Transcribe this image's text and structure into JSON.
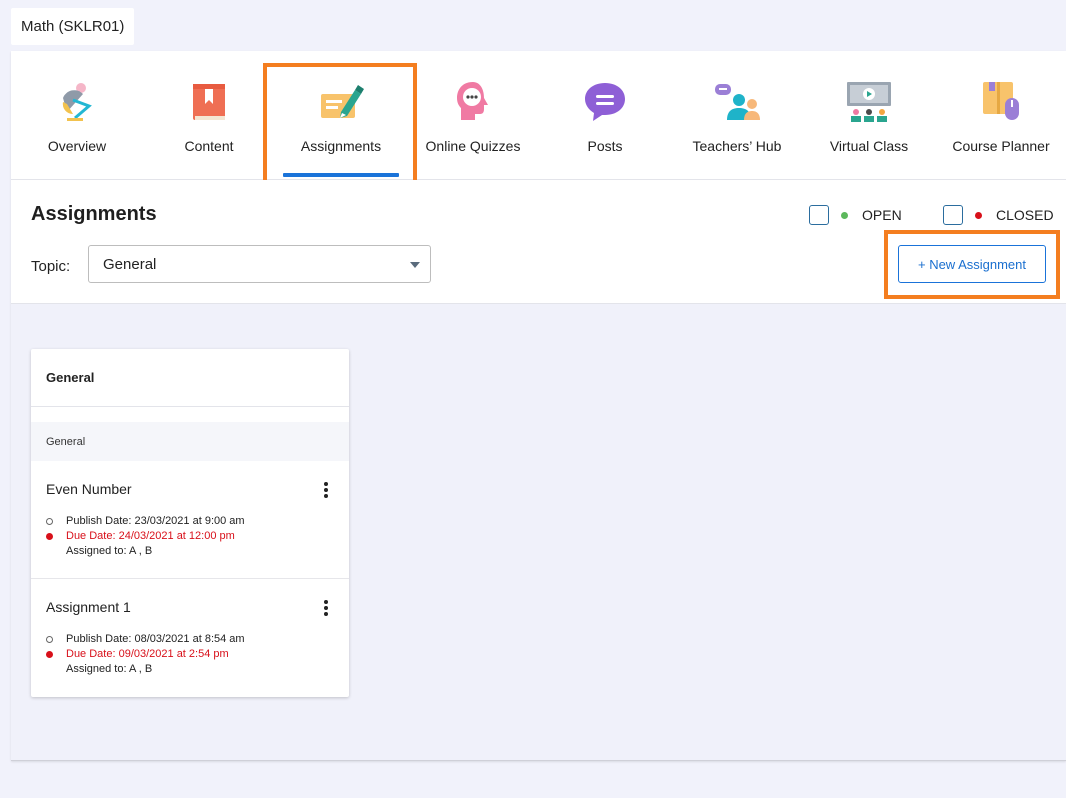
{
  "course": {
    "name": "Math (SKLR01)"
  },
  "nav": {
    "items": [
      {
        "label": "Overview",
        "icon": "desk-lamp-icon"
      },
      {
        "label": "Content",
        "icon": "book-icon"
      },
      {
        "label": "Assignments",
        "icon": "pen-paper-icon",
        "active": true
      },
      {
        "label": "Online Quizzes",
        "icon": "quiz-head-icon"
      },
      {
        "label": "Posts",
        "icon": "chat-bubble-icon"
      },
      {
        "label": "Teachers’ Hub",
        "icon": "people-chat-icon"
      },
      {
        "label": "Virtual Class",
        "icon": "video-screen-icon"
      },
      {
        "label": "Course Planner",
        "icon": "planner-mouse-icon"
      }
    ]
  },
  "header": {
    "title": "Assignments",
    "legend": {
      "open_label": "OPEN",
      "closed_label": "CLOSED"
    },
    "topic_label": "Topic:",
    "topic_value": "General",
    "new_button_label": "+ New Assignment"
  },
  "card": {
    "title": "General",
    "subheader": "General",
    "assignments": [
      {
        "title": "Even Number",
        "publish": "Publish Date: 23/03/2021 at 9:00 am",
        "due": "Due Date: 24/03/2021 at 12:00 pm",
        "assigned": "Assigned to: A , B"
      },
      {
        "title": "Assignment 1",
        "publish": "Publish Date: 08/03/2021 at 8:54 am",
        "due": "Due Date: 09/03/2021 at 2:54 pm",
        "assigned": "Assigned to: A , B"
      }
    ]
  },
  "colors": {
    "accent": "#1a73d9",
    "highlight": "#f47e20",
    "open_dot": "#5cb85c",
    "closed_dot": "#d8101a"
  }
}
